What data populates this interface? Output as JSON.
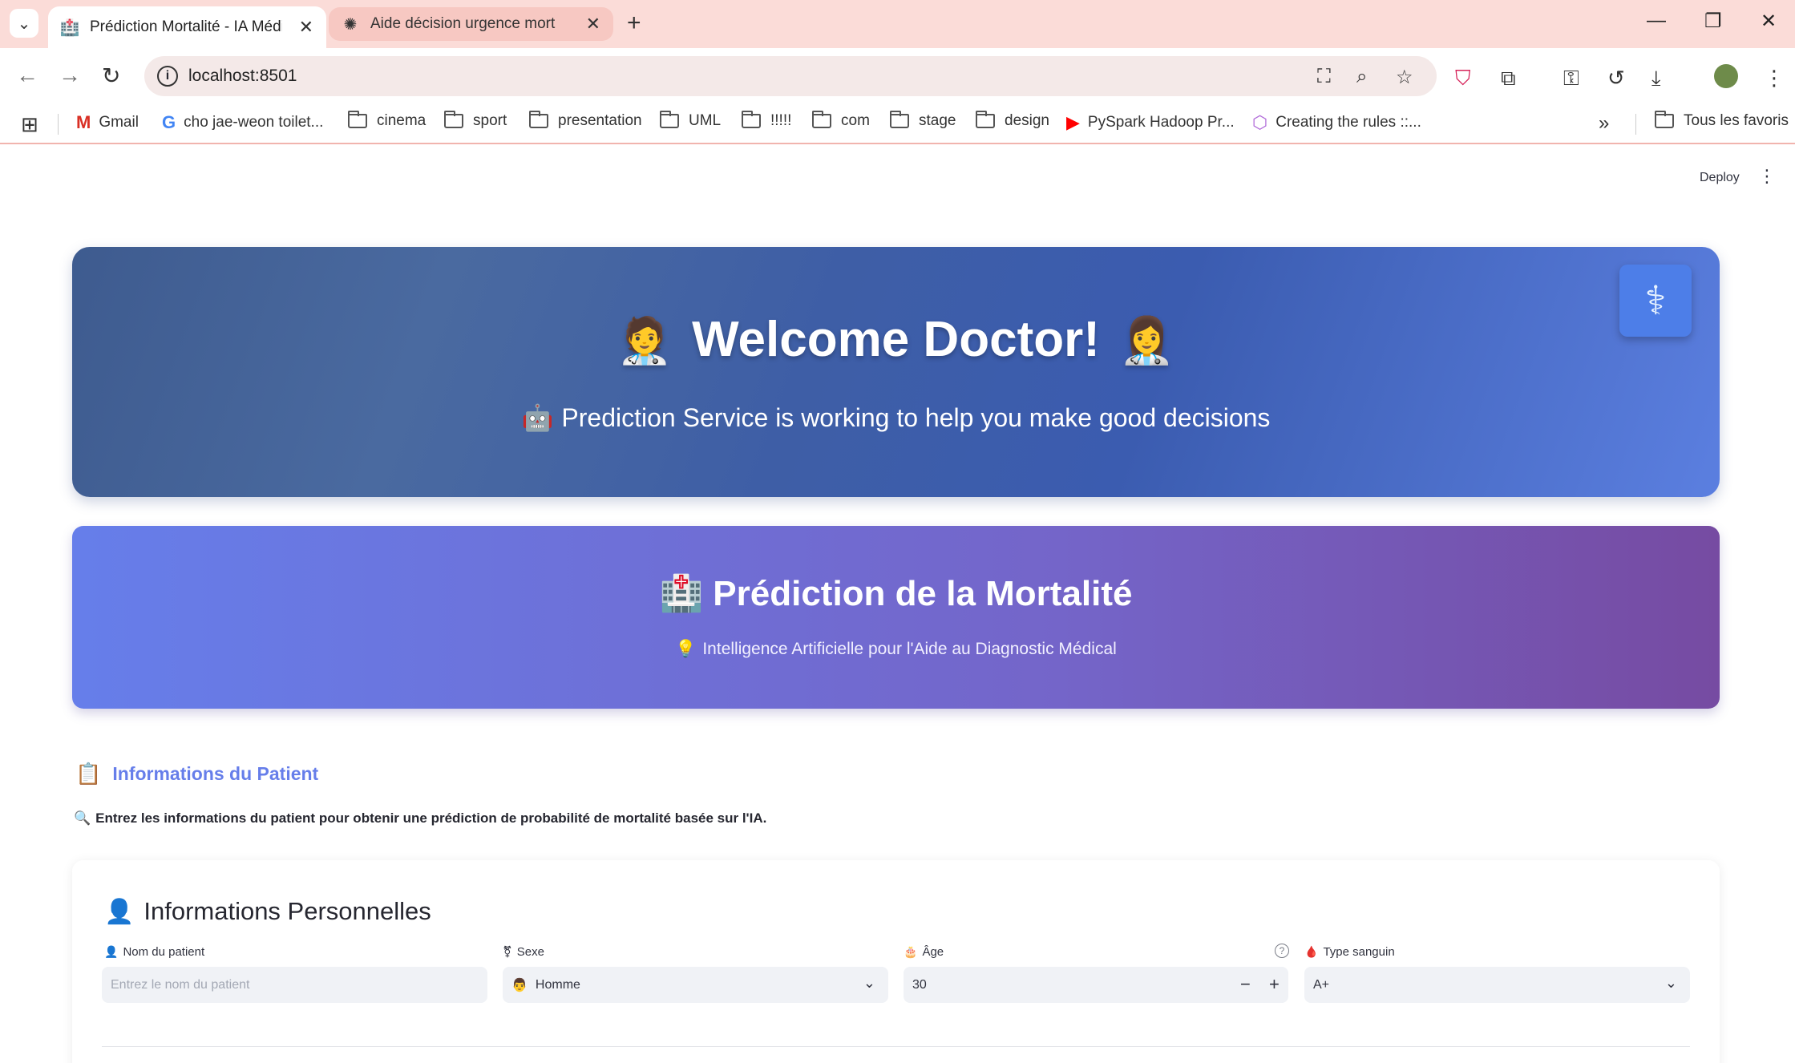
{
  "browser": {
    "tabs": [
      {
        "title": "Prédiction Mortalité - IA Médicale",
        "favicon": "hospital-icon",
        "active": true
      },
      {
        "title": "Aide décision urgence mort",
        "favicon": "chatgpt-icon",
        "active": false
      }
    ],
    "url": "localhost:8501",
    "bookmarks": [
      {
        "label": "Gmail",
        "icon": "gmail-icon"
      },
      {
        "label": "cho jae-weon toilet...",
        "icon": "google-icon"
      },
      {
        "label": "cinema",
        "icon": "folder-icon"
      },
      {
        "label": "sport",
        "icon": "folder-icon"
      },
      {
        "label": "presentation",
        "icon": "folder-icon"
      },
      {
        "label": "UML",
        "icon": "folder-icon"
      },
      {
        "label": "!!!!!",
        "icon": "folder-icon"
      },
      {
        "label": "com",
        "icon": "folder-icon"
      },
      {
        "label": "stage",
        "icon": "folder-icon"
      },
      {
        "label": "design",
        "icon": "folder-icon"
      },
      {
        "label": "PySpark Hadoop Pr...",
        "icon": "youtube-icon"
      },
      {
        "label": "Creating the rules ::...",
        "icon": "cube-icon"
      }
    ],
    "all_bookmarks": "Tous les favoris"
  },
  "app": {
    "deploy_label": "Deploy",
    "hero": {
      "emoji_left": "🧑‍⚕️",
      "title": "Welcome Doctor!",
      "emoji_right": "👩‍⚕️",
      "sub_emoji": "🤖",
      "subtitle": "Prediction Service is working to help you make good decisions"
    },
    "banner": {
      "emoji": "🏥",
      "title": "Prédiction de la Mortalité",
      "sub_emoji": "💡",
      "subtitle": "Intelligence Artificielle pour l'Aide au Diagnostic Médical"
    },
    "patient_section": {
      "emoji": "📋",
      "title": "Informations du Patient",
      "intro_emoji": "🔍",
      "intro": "Entrez les informations du patient pour obtenir une prédiction de probabilité de mortalité basée sur l'IA."
    },
    "personal": {
      "emoji": "👤",
      "title": "Informations Personnelles",
      "name": {
        "emoji": "👤",
        "label": "Nom du patient",
        "placeholder": "Entrez le nom du patient"
      },
      "sex": {
        "emoji": "⚧",
        "label": "Sexe",
        "value_emoji": "👨",
        "value": "Homme"
      },
      "age": {
        "emoji": "🎂",
        "label": "Âge",
        "value": "30"
      },
      "blood": {
        "emoji": "🩸",
        "label": "Type sanguin",
        "value": "A+"
      }
    }
  }
}
